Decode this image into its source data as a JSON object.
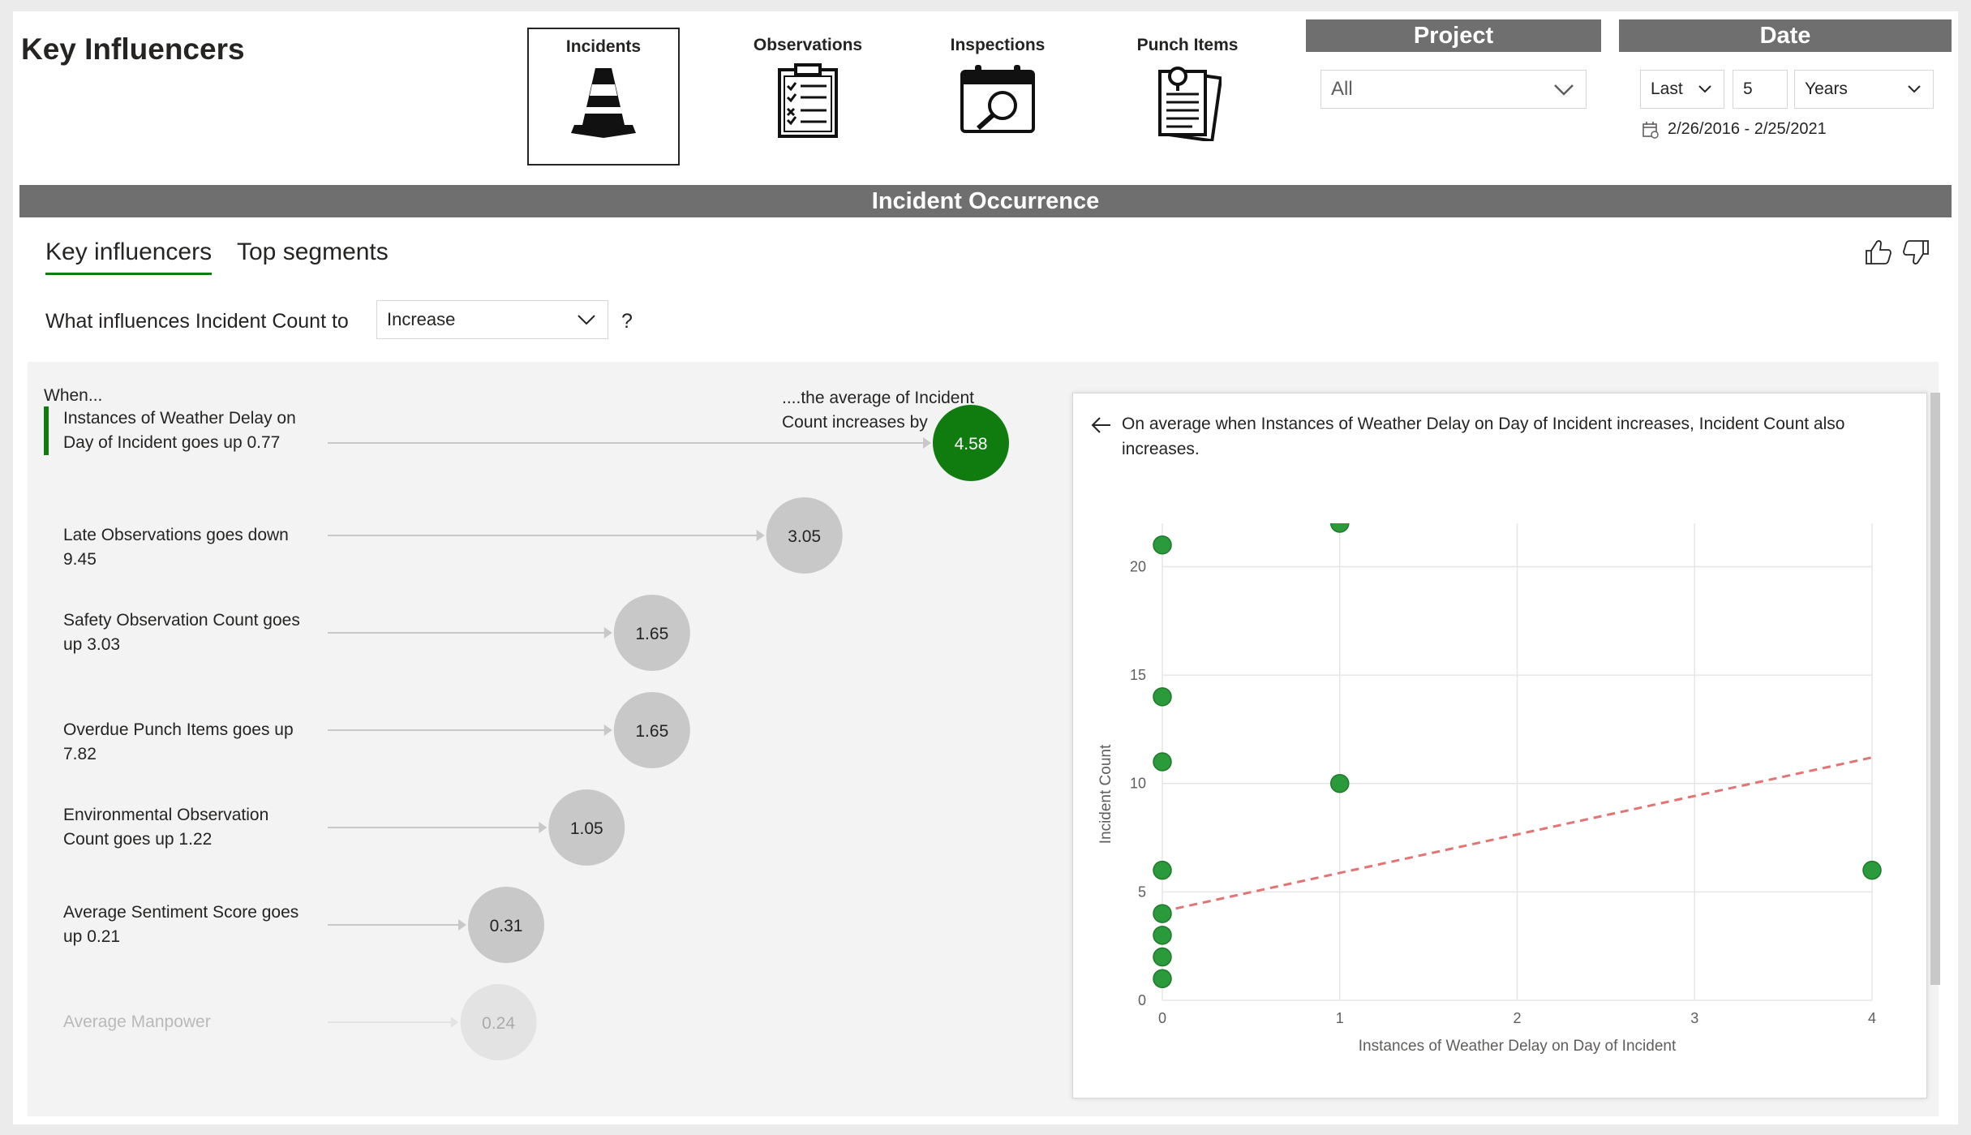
{
  "title": "Key Influencers",
  "nav": [
    {
      "label": "Incidents",
      "icon": "traffic-cone-icon",
      "active": true
    },
    {
      "label": "Observations",
      "icon": "clipboard-checklist-icon",
      "active": false
    },
    {
      "label": "Inspections",
      "icon": "calendar-search-icon",
      "active": false
    },
    {
      "label": "Punch Items",
      "icon": "document-pin-icon",
      "active": false
    }
  ],
  "project": {
    "header": "Project",
    "value": "All"
  },
  "date": {
    "header": "Date",
    "period": "Last",
    "count": "5",
    "unit": "Years",
    "range": "2/26/2016 - 2/25/2021"
  },
  "section_title": "Incident Occurrence",
  "tabs": {
    "key_influencers": "Key influencers",
    "top_segments": "Top segments"
  },
  "question": {
    "prefix": "What influences Incident Count to",
    "value": "Increase",
    "suffix": "?"
  },
  "panel": {
    "when": "When...",
    "avg": "....the average of Incident Count increases by"
  },
  "influencers": [
    {
      "label": "Instances of Weather Delay on Day of Incident goes up 0.77",
      "value": "4.58",
      "v": 4.58,
      "selected": true
    },
    {
      "label": "Late Observations goes down 9.45",
      "value": "3.05",
      "v": 3.05
    },
    {
      "label": "Safety Observation Count goes up 3.03",
      "value": "1.65",
      "v": 1.65
    },
    {
      "label": "Overdue Punch Items goes up 7.82",
      "value": "1.65",
      "v": 1.65
    },
    {
      "label": "Environmental Observation Count goes up 1.22",
      "value": "1.05",
      "v": 1.05
    },
    {
      "label": "Average Sentiment Score goes up 0.21",
      "value": "0.31",
      "v": 0.31
    },
    {
      "label": "Average Manpower",
      "value": "0.24",
      "v": 0.24,
      "faded": true
    }
  ],
  "detail": {
    "text": "On average when Instances of Weather Delay on Day of Incident increases, Incident Count also increases."
  },
  "chart_data": {
    "type": "scatter",
    "xlabel": "Instances of Weather Delay on Day of Incident",
    "ylabel": "Incident Count",
    "xlim": [
      0,
      4
    ],
    "ylim": [
      0,
      22
    ],
    "xticks": [
      0,
      1,
      2,
      3,
      4
    ],
    "yticks": [
      0,
      5,
      10,
      15,
      20
    ],
    "grid": true,
    "points": [
      {
        "x": 0,
        "y": 21
      },
      {
        "x": 0,
        "y": 14
      },
      {
        "x": 0,
        "y": 11
      },
      {
        "x": 0,
        "y": 6
      },
      {
        "x": 0,
        "y": 4
      },
      {
        "x": 0,
        "y": 3
      },
      {
        "x": 0,
        "y": 2
      },
      {
        "x": 0,
        "y": 1
      },
      {
        "x": 1,
        "y": 22
      },
      {
        "x": 1,
        "y": 10
      },
      {
        "x": 4,
        "y": 6
      }
    ],
    "trendline": {
      "x1": 0,
      "y1": 4.1,
      "x2": 4,
      "y2": 11.2,
      "color": "#e37474",
      "style": "dashed"
    },
    "point_color": "#2a9a3a"
  },
  "colors": {
    "accent": "#107c10",
    "band": "#6f6f6f",
    "bubble_gray": "#c8c8c8"
  }
}
